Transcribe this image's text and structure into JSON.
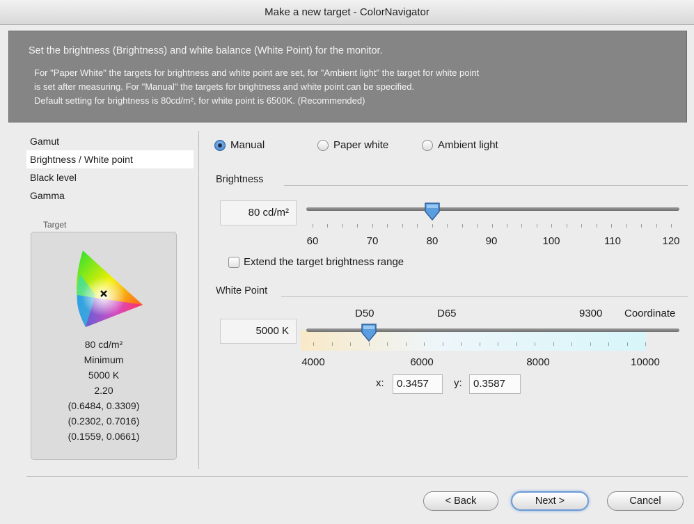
{
  "window": {
    "title": "Make a new target - ColorNavigator"
  },
  "info": {
    "heading": "Set the brightness (Brightness) and white balance (White Point) for the monitor.",
    "lines": [
      "For \"Paper White\" the targets for brightness and white point are set, for \"Ambient light\" the target for white point",
      "is set after measuring. For \"Manual\" the targets for brightness and white point can be specified.",
      "Default setting for brightness is 80cd/m², for white point is 6500K. (Recommended)"
    ]
  },
  "nav": {
    "items": [
      {
        "label": "Gamut",
        "selected": false
      },
      {
        "label": "Brightness / White point",
        "selected": true
      },
      {
        "label": "Black level",
        "selected": false
      },
      {
        "label": "Gamma",
        "selected": false
      }
    ]
  },
  "target": {
    "label": "Target",
    "values": [
      "80 cd/m²",
      "Minimum",
      "5000 K",
      "2.20",
      "(0.6484, 0.3309)",
      "(0.2302, 0.7016)",
      "(0.1559, 0.0661)"
    ]
  },
  "mode": {
    "options": [
      {
        "label": "Manual",
        "selected": true
      },
      {
        "label": "Paper white",
        "selected": false
      },
      {
        "label": "Ambient light",
        "selected": false
      }
    ]
  },
  "brightness": {
    "title": "Brightness",
    "value_text": "80 cd/m²",
    "value": 80,
    "min": 60,
    "max": 120,
    "tick_labels": [
      "60",
      "70",
      "80",
      "90",
      "100",
      "110",
      "120"
    ],
    "extend_label": "Extend the target brightness range",
    "extend_checked": false
  },
  "white_point": {
    "title": "White Point",
    "value_text": "5000 K",
    "value": 5000,
    "min": 4000,
    "max": 10000,
    "presets": [
      "D50",
      "D65",
      "9300",
      "Coordinate"
    ],
    "tick_labels": [
      "4000",
      "6000",
      "8000",
      "10000"
    ],
    "x_label": "x:",
    "x_value": "0.3457",
    "y_label": "y:",
    "y_value": "0.3587"
  },
  "buttons": {
    "back": "< Back",
    "next": "Next >",
    "cancel": "Cancel"
  },
  "colors": {
    "info_bg": "#858585",
    "accent": "#3a78c9",
    "slider_thumb": "#5b9ee0"
  }
}
